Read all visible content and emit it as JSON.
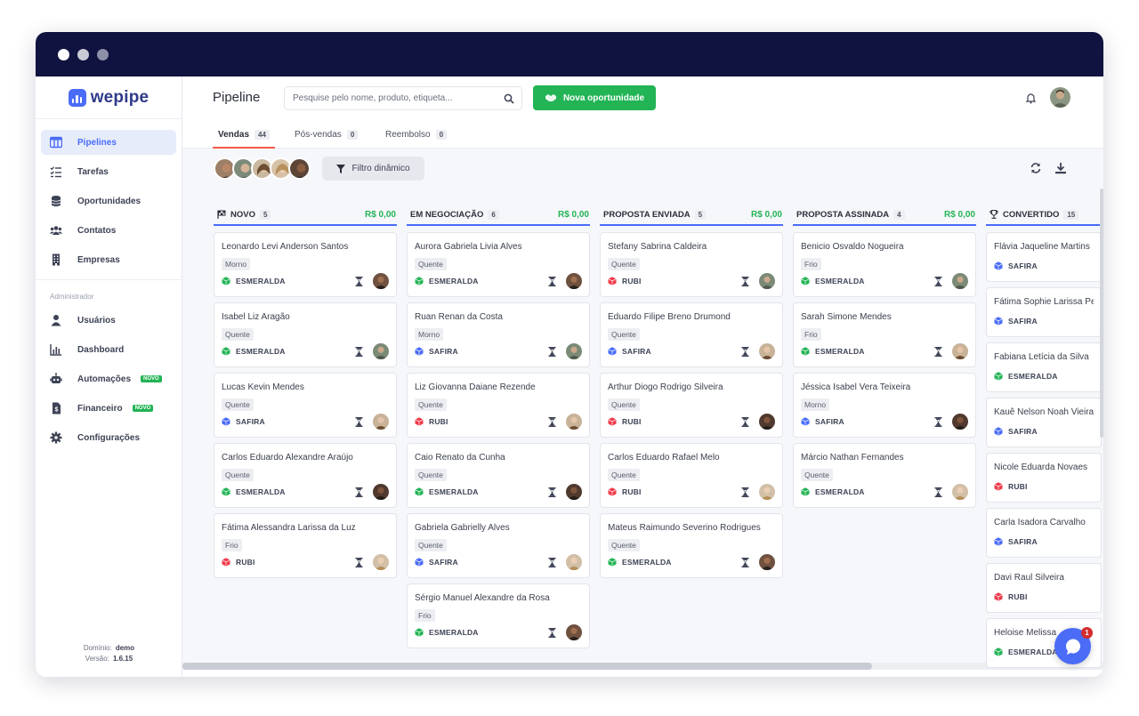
{
  "app": {
    "logo": "wepipe"
  },
  "sidebar": {
    "items": [
      {
        "label": "Pipelines",
        "icon": "board-icon",
        "active": true
      },
      {
        "label": "Tarefas",
        "icon": "tasks-icon"
      },
      {
        "label": "Oportunidades",
        "icon": "coins-icon"
      },
      {
        "label": "Contatos",
        "icon": "people-icon"
      },
      {
        "label": "Empresas",
        "icon": "building-icon"
      }
    ],
    "admin_label": "Administrador",
    "admin_items": [
      {
        "label": "Usuários",
        "icon": "user-icon"
      },
      {
        "label": "Dashboard",
        "icon": "chart-icon"
      },
      {
        "label": "Automações",
        "icon": "robot-icon",
        "badge": "NOVO"
      },
      {
        "label": "Financeiro",
        "icon": "invoice-icon",
        "badge": "NOVO"
      },
      {
        "label": "Configurações",
        "icon": "gear-icon"
      }
    ],
    "footer": {
      "domain_label": "Domínio:",
      "domain": "demo",
      "version_label": "Versão:",
      "version": "1.6.15"
    }
  },
  "header": {
    "title": "Pipeline",
    "search_placeholder": "Pesquise pelo nome, produto, etiqueta...",
    "new_button": "Nova oportunidade"
  },
  "tabs": [
    {
      "label": "Vendas",
      "count": "44",
      "active": true
    },
    {
      "label": "Pós-vendas",
      "count": "0"
    },
    {
      "label": "Reembolso",
      "count": "0"
    }
  ],
  "filter": {
    "label": "Filtro dinâmico"
  },
  "chat": {
    "badge": "1"
  },
  "colors": {
    "accent": "#4a6cf7",
    "green": "#22b455",
    "esmeralda": "#22b455",
    "safira": "#4a6cf7",
    "rubi": "#ef3b4b"
  },
  "columns": [
    {
      "title": "NOVO",
      "icon": "flag-icon",
      "count": "5",
      "total": "R$ 0,00",
      "cards": [
        {
          "name": "Leonardo Levi Anderson Santos",
          "tag": "Morno",
          "product": "ESMERALDA",
          "gem": "esmeralda"
        },
        {
          "name": "Isabel Liz Aragão",
          "tag": "Quente",
          "product": "ESMERALDA",
          "gem": "esmeralda"
        },
        {
          "name": "Lucas Kevin Mendes",
          "tag": "Quente",
          "product": "SAFIRA",
          "gem": "safira"
        },
        {
          "name": "Carlos Eduardo Alexandre Araújo",
          "tag": "Quente",
          "product": "ESMERALDA",
          "gem": "esmeralda"
        },
        {
          "name": "Fátima Alessandra Larissa da Luz",
          "tag": "Frio",
          "product": "RUBI",
          "gem": "rubi"
        }
      ]
    },
    {
      "title": "EM NEGOCIAÇÃO",
      "count": "6",
      "total": "R$ 0,00",
      "cards": [
        {
          "name": "Aurora Gabriela Livia Alves",
          "tag": "Quente",
          "product": "ESMERALDA",
          "gem": "esmeralda"
        },
        {
          "name": "Ruan Renan da Costa",
          "tag": "Morno",
          "product": "SAFIRA",
          "gem": "safira"
        },
        {
          "name": "Liz Giovanna Daiane Rezende",
          "tag": "Quente",
          "product": "RUBI",
          "gem": "rubi"
        },
        {
          "name": "Caio Renato da Cunha",
          "tag": "Quente",
          "product": "ESMERALDA",
          "gem": "esmeralda"
        },
        {
          "name": "Gabriela Gabrielly Alves",
          "tag": "Quente",
          "product": "SAFIRA",
          "gem": "safira"
        },
        {
          "name": "Sérgio Manuel Alexandre da Rosa",
          "tag": "Frio",
          "product": "ESMERALDA",
          "gem": "esmeralda"
        }
      ]
    },
    {
      "title": "PROPOSTA ENVIADA",
      "count": "5",
      "total": "R$ 0,00",
      "cards": [
        {
          "name": "Stefany Sabrina Caldeira",
          "tag": "Quente",
          "product": "RUBI",
          "gem": "rubi"
        },
        {
          "name": "Eduardo Filipe Breno Drumond",
          "tag": "Quente",
          "product": "SAFIRA",
          "gem": "safira"
        },
        {
          "name": "Arthur Diogo Rodrigo Silveira",
          "tag": "Quente",
          "product": "RUBI",
          "gem": "rubi"
        },
        {
          "name": "Carlos Eduardo Rafael Melo",
          "tag": "Quente",
          "product": "RUBI",
          "gem": "rubi"
        },
        {
          "name": "Mateus Raimundo Severino Rodrigues",
          "tag": "Quente",
          "product": "ESMERALDA",
          "gem": "esmeralda"
        }
      ]
    },
    {
      "title": "PROPOSTA ASSINADA",
      "count": "4",
      "total": "R$ 0,00",
      "cards": [
        {
          "name": "Benicio Osvaldo Nogueira",
          "tag": "Frio",
          "product": "ESMERALDA",
          "gem": "esmeralda"
        },
        {
          "name": "Sarah Simone Mendes",
          "tag": "Frio",
          "product": "ESMERALDA",
          "gem": "esmeralda"
        },
        {
          "name": "Jéssica Isabel Vera Teixeira",
          "tag": "Morno",
          "product": "SAFIRA",
          "gem": "safira"
        },
        {
          "name": "Márcio Nathan Fernandes",
          "tag": "Quente",
          "product": "ESMERALDA",
          "gem": "esmeralda"
        }
      ]
    },
    {
      "title": "CONVERTIDO",
      "icon": "trophy-icon",
      "count": "15",
      "cards": [
        {
          "name": "Flávia Jaqueline Martins",
          "product": "SAFIRA",
          "gem": "safira"
        },
        {
          "name": "Fátima Sophie Larissa Pe",
          "product": "SAFIRA",
          "gem": "safira"
        },
        {
          "name": "Fabiana Letícia da Silva",
          "product": "ESMERALDA",
          "gem": "esmeralda"
        },
        {
          "name": "Kauê Nelson Noah Vieira",
          "product": "SAFIRA",
          "gem": "safira"
        },
        {
          "name": "Nicole Eduarda Novaes",
          "product": "RUBI",
          "gem": "rubi"
        },
        {
          "name": "Carla Isadora Carvalho",
          "product": "SAFIRA",
          "gem": "safira"
        },
        {
          "name": "Davi Raul Silveira",
          "product": "RUBI",
          "gem": "rubi"
        },
        {
          "name": "Heloise Melissa",
          "product": "ESMERALDA",
          "gem": "esmeralda"
        }
      ]
    }
  ]
}
